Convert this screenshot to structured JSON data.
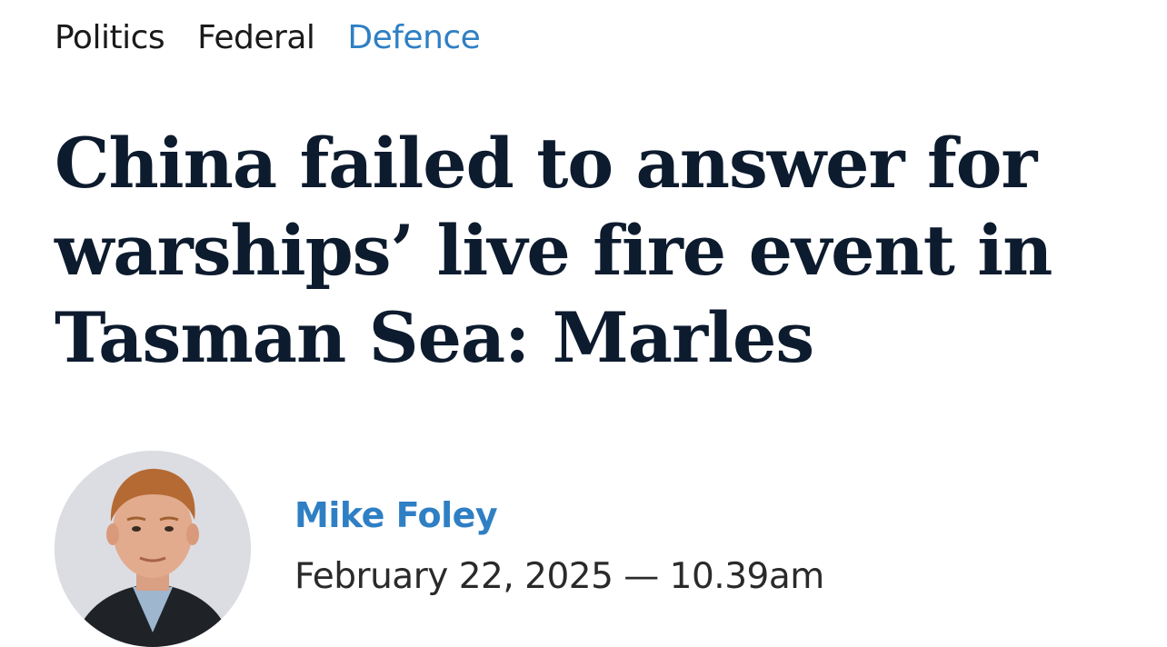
{
  "breadcrumb": {
    "items": [
      {
        "label": "Politics",
        "active": false
      },
      {
        "label": "Federal",
        "active": false
      },
      {
        "label": "Defence",
        "active": true
      }
    ]
  },
  "article": {
    "headline": "China failed to answer for warships’ live fire event in Tasman Sea: Marles",
    "author": "Mike Foley",
    "timestamp": "February 22, 2025 — 10.39am"
  },
  "colors": {
    "accent": "#2f7fc4",
    "headline": "#0d1b2e",
    "text": "#1a1a1a"
  }
}
